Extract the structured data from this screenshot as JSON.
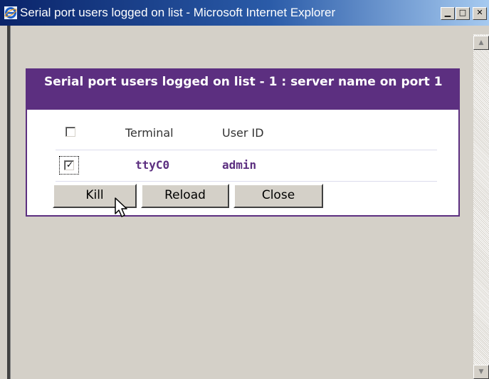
{
  "window": {
    "title": "Serial port users logged on list - Microsoft Internet Explorer",
    "controls": {
      "minimize": "▁",
      "maximize": "□",
      "close": "✕"
    },
    "icon": "ie-icon"
  },
  "panel": {
    "title": "Serial port users logged on list - 1 : server name on port 1",
    "columns": {
      "terminal": "Terminal",
      "user_id": "User ID"
    },
    "rows": [
      {
        "checked": true,
        "terminal": "ttyC0",
        "user_id": "admin"
      }
    ],
    "buttons": {
      "kill": "Kill",
      "reload": "Reload",
      "close": "Close"
    }
  },
  "scrollbar": {
    "up": "▲",
    "down": "▼"
  },
  "colors": {
    "accent": "#5c2f80",
    "titlebar_start": "#0a246a",
    "titlebar_end": "#a6caf0",
    "background": "#d4d0c8"
  },
  "icons": [
    "ie-icon",
    "checkbox",
    "mouse-pointer-icon"
  ]
}
